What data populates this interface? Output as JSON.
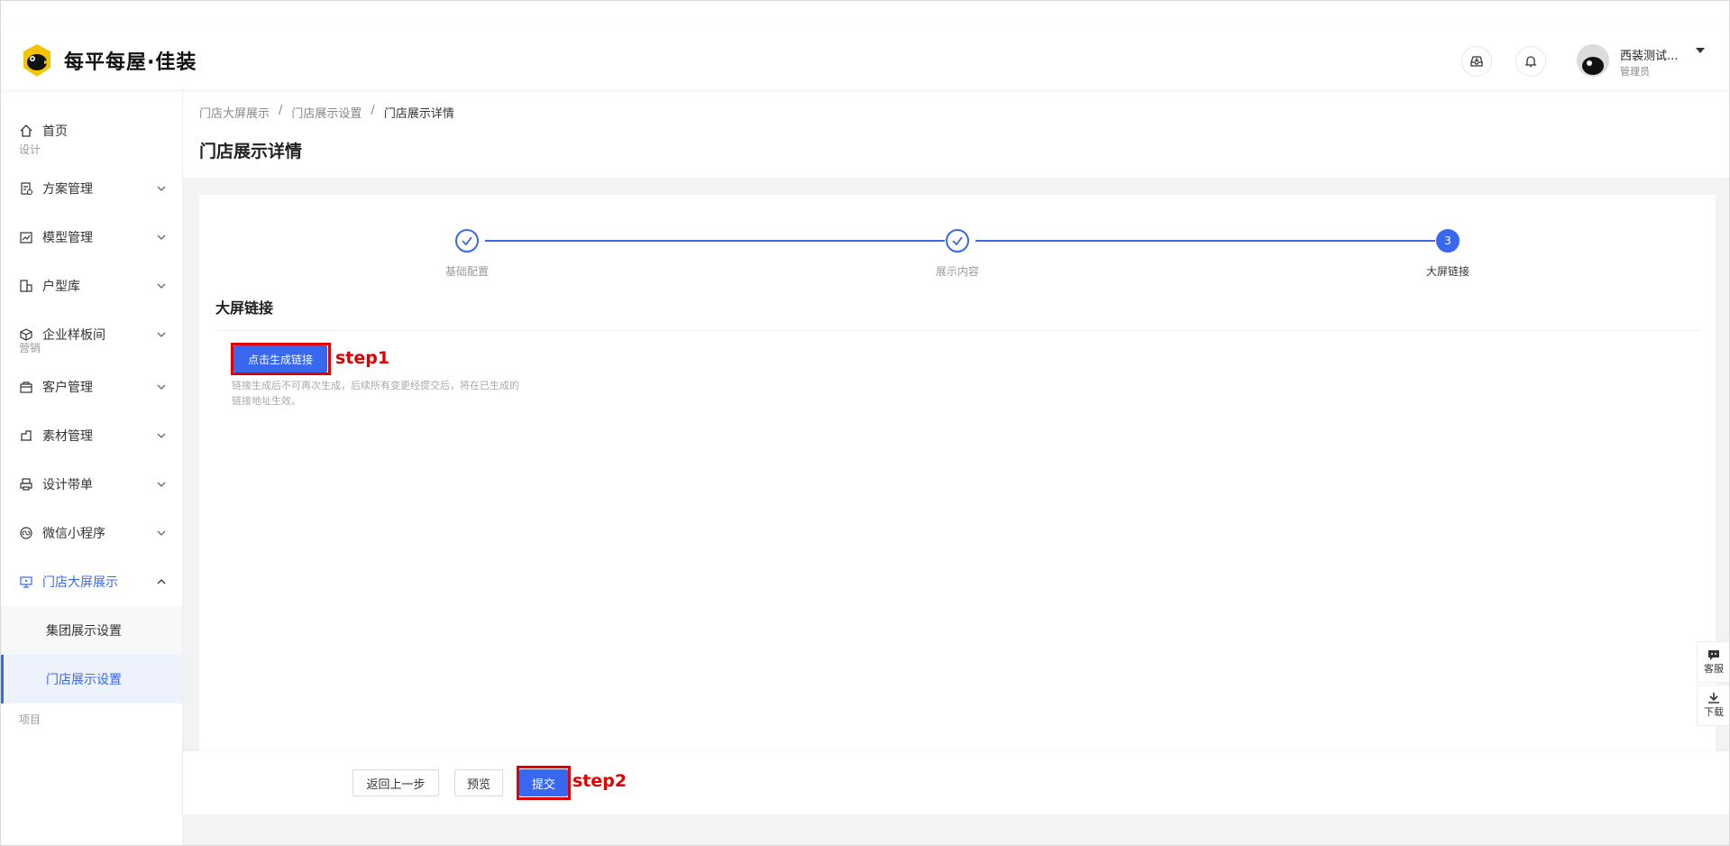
{
  "header": {
    "logo_text": "每平每屋·佳装",
    "user_name": "西装测试...",
    "user_role": "管理员",
    "icons": [
      "inbox-icon",
      "bell-icon"
    ]
  },
  "sidebar": {
    "home": "首页",
    "group_design": "设计",
    "group_marketing": "营销",
    "group_project": "项目",
    "items": [
      {
        "label": "方案管理",
        "icon": "document-icon"
      },
      {
        "label": "模型管理",
        "icon": "chart-icon"
      },
      {
        "label": "户型库",
        "icon": "floorplan-icon"
      },
      {
        "label": "企业样板间",
        "icon": "box-icon"
      },
      {
        "label": "客户管理",
        "icon": "customer-icon"
      },
      {
        "label": "素材管理",
        "icon": "material-icon"
      },
      {
        "label": "设计带单",
        "icon": "printer-icon"
      },
      {
        "label": "微信小程序",
        "icon": "miniprogram-icon"
      },
      {
        "label": "门店大屏展示",
        "icon": "screen-icon"
      }
    ],
    "sub_items": [
      {
        "label": "集团展示设置",
        "active": false
      },
      {
        "label": "门店展示设置",
        "active": true
      }
    ]
  },
  "breadcrumb": [
    "门店大屏展示",
    "门店展示设置",
    "门店展示详情"
  ],
  "page_title": "门店展示详情",
  "steps": [
    {
      "label": "基础配置",
      "status": "done"
    },
    {
      "label": "展示内容",
      "status": "done"
    },
    {
      "label": "大屏链接",
      "status": "current",
      "number": "3"
    }
  ],
  "section_title": "大屏链接",
  "generate_button": "点击生成链接",
  "hint": "链接生成后不可再次生成，后续所有变更经提交后，将在已生成的链接地址生效。",
  "annotations": {
    "step1": "step1",
    "step2": "step2"
  },
  "footer": {
    "back": "返回上一步",
    "preview": "预览",
    "submit": "提交"
  },
  "float_tools": {
    "service": "客服",
    "download": "下载"
  },
  "colors": {
    "primary": "#3867f0",
    "annotation_red": "#e00000"
  }
}
